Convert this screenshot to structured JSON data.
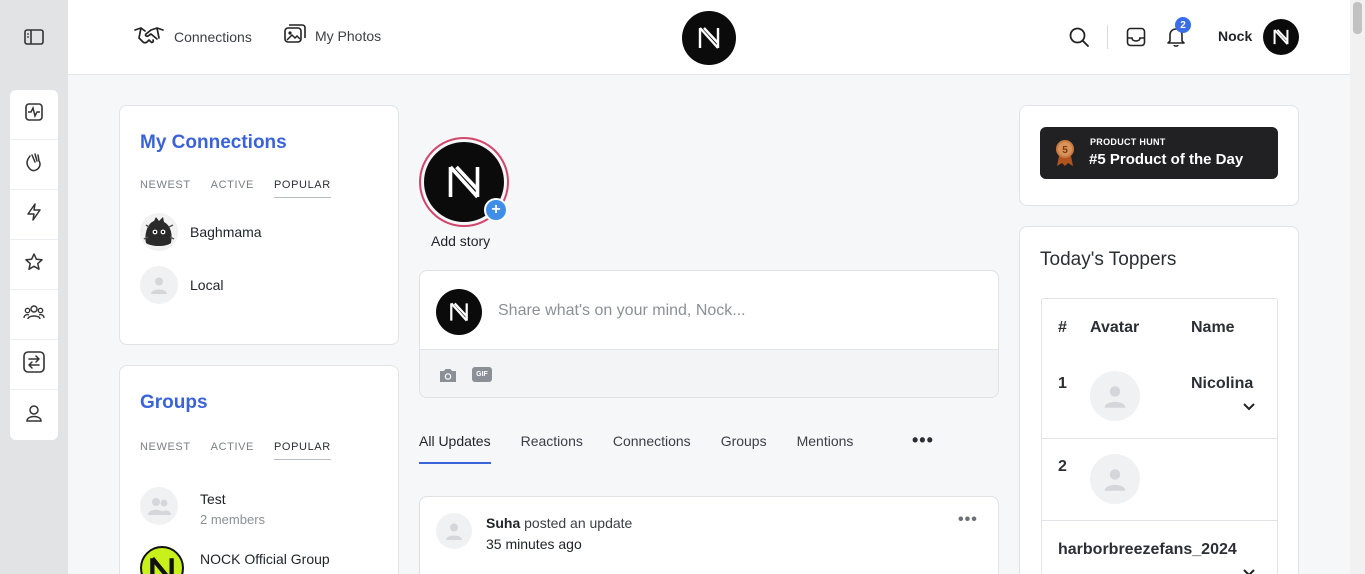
{
  "header": {
    "nav": [
      {
        "label": "Connections",
        "icon": "handshake-icon"
      },
      {
        "label": "My Photos",
        "icon": "photos-icon"
      }
    ],
    "user_name": "Nock",
    "notification_count": "2"
  },
  "rail": {
    "items": [
      "activity-icon",
      "wave-hand-icon",
      "bolt-icon",
      "star-icon",
      "group-icon",
      "swap-icon",
      "profile-icon"
    ]
  },
  "connections": {
    "title": "My Connections",
    "tabs": [
      "NEWEST",
      "ACTIVE",
      "POPULAR"
    ],
    "active_tab": "POPULAR",
    "people": [
      {
        "name": "Baghmama"
      },
      {
        "name": "Local"
      }
    ]
  },
  "groups": {
    "title": "Groups",
    "tabs": [
      "NEWEST",
      "ACTIVE",
      "POPULAR"
    ],
    "active_tab": "POPULAR",
    "items": [
      {
        "name": "Test",
        "members": "2 members"
      },
      {
        "name": "NOCK Official Group"
      }
    ]
  },
  "story": {
    "label": "Add story"
  },
  "composer": {
    "placeholder": "Share what's on your mind, Nock...",
    "gif_label": "GIF"
  },
  "feed": {
    "tabs": [
      "All Updates",
      "Reactions",
      "Connections",
      "Groups",
      "Mentions"
    ],
    "active_tab": "All Updates",
    "more": "•••"
  },
  "post": {
    "author": "Suha",
    "action": " posted an update",
    "time": "35 minutes ago",
    "more": "•••"
  },
  "product_hunt": {
    "top_line": "PRODUCT HUNT",
    "main_line": "#5 Product of the Day",
    "medal_number": "5"
  },
  "toppers": {
    "title": "Today's Toppers",
    "columns": [
      "#",
      "Avatar",
      "Name"
    ],
    "rows": [
      {
        "rank": "1",
        "name": "Nicolina"
      },
      {
        "rank": "2",
        "name": ""
      },
      {
        "rank": "",
        "name": "harborbreezefans_2024"
      }
    ]
  },
  "colors": {
    "accent": "#3b63d9",
    "badge": "#3a6ee8",
    "story_ring": "#d1466b"
  }
}
